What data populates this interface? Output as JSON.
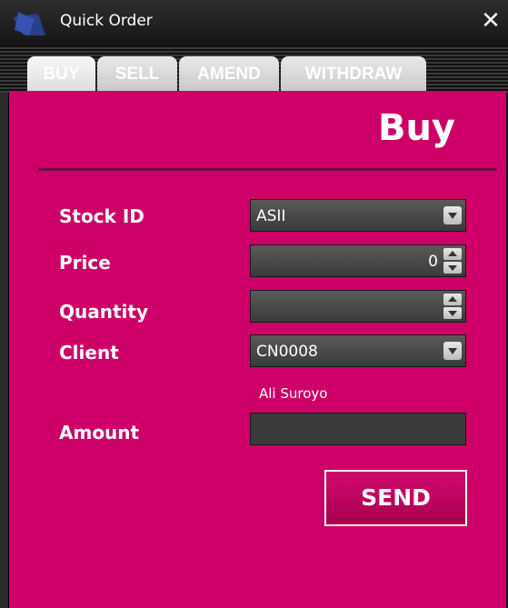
{
  "window": {
    "title": "Quick Order",
    "close_icon": "close-icon",
    "logo_icon": "app-logo-icon"
  },
  "tabs": [
    {
      "label": "BUY",
      "active": true
    },
    {
      "label": "SELL",
      "active": false
    },
    {
      "label": "AMEND",
      "active": false
    },
    {
      "label": "WITHDRAW",
      "active": false
    }
  ],
  "form": {
    "heading": "Buy",
    "stock_id_label": "Stock ID",
    "stock_id_value": "ASII",
    "price_label": "Price",
    "price_value": "0",
    "quantity_label": "Quantity",
    "quantity_value": "",
    "client_label": "Client",
    "client_value": "CN0008",
    "client_name": "Ali Suroyo",
    "amount_label": "Amount",
    "amount_value": "",
    "send_label": "SEND"
  },
  "colors": {
    "panel": "#cc0066",
    "titlebar": "#1c1c1c",
    "field": "#4a4a4a"
  }
}
